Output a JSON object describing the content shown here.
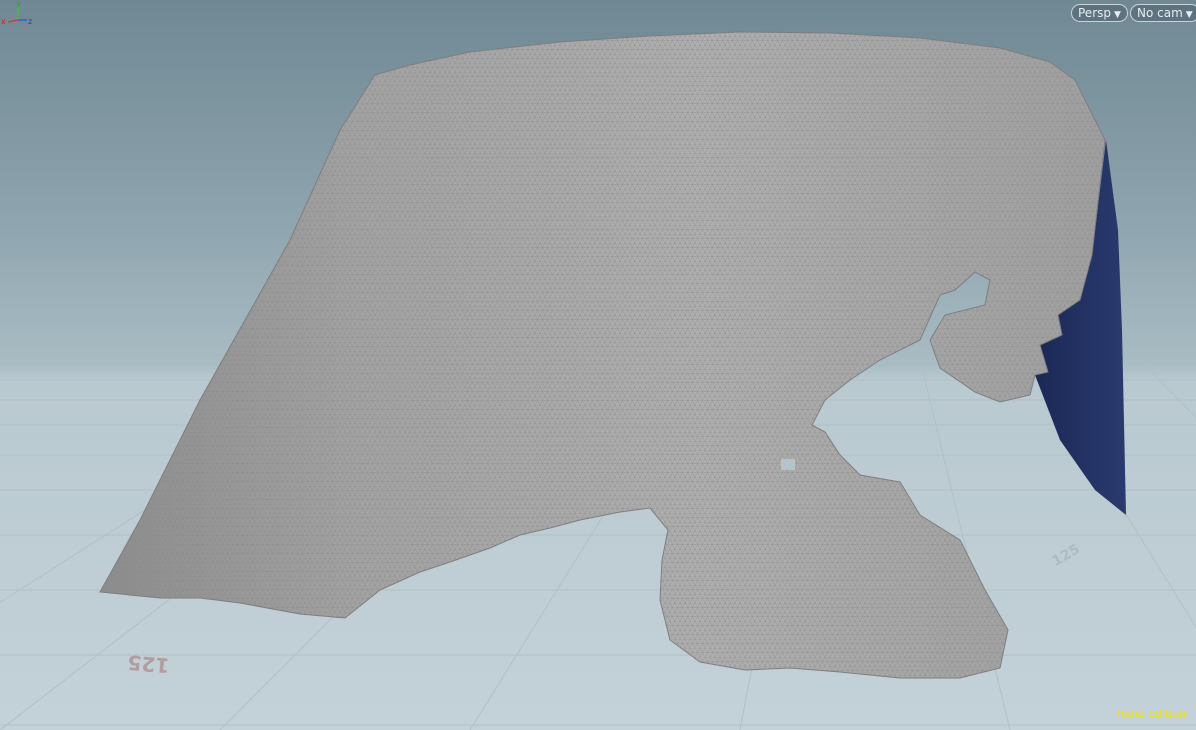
{
  "viewport": {
    "camera_mode_label": "Persp",
    "camera_label": "No cam",
    "edition_label": "Indie Edition",
    "grid_numbers": [
      "125",
      "125"
    ],
    "axis_labels": {
      "x": "x",
      "y": "y",
      "z": "z"
    },
    "icons": {
      "dropdown": "caret-down-icon"
    },
    "colors": {
      "background_top": "#6f8893",
      "background_bottom": "#c3d2d8",
      "mesh": "#a6a6a6",
      "mesh_wire": "#8a8a8a",
      "backface": "#1e2b57",
      "edition_text": "#f2e300"
    }
  }
}
